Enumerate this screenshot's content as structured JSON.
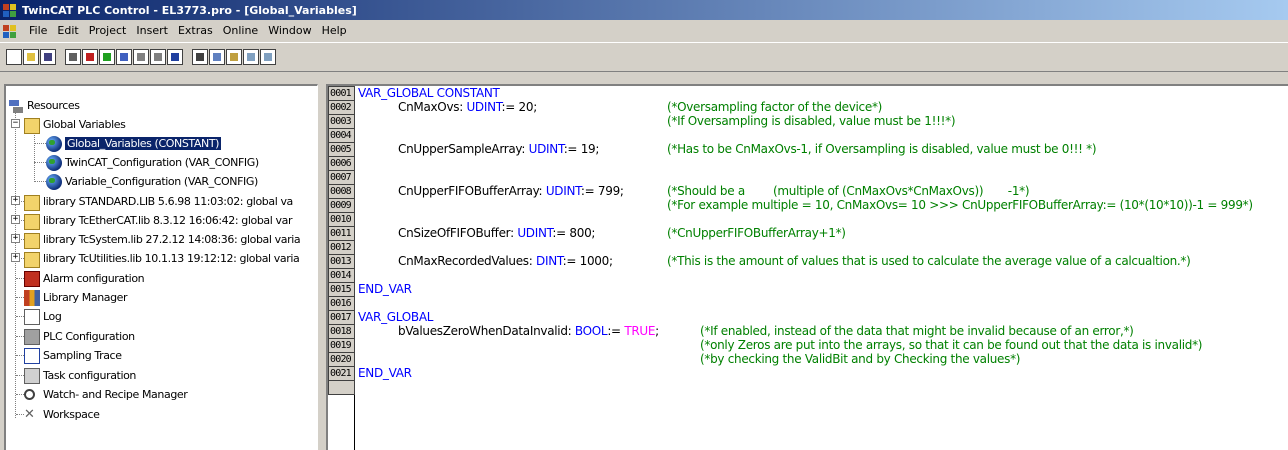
{
  "window": {
    "title": "TwinCAT PLC Control - EL3773.pro - [Global_Variables]"
  },
  "menu": [
    "File",
    "Edit",
    "Project",
    "Insert",
    "Extras",
    "Online",
    "Window",
    "Help"
  ],
  "toolbar": {
    "buttons": [
      "new",
      "open",
      "save",
      "compile",
      "login",
      "logout",
      "run",
      "stop",
      "step",
      "cut",
      "copy",
      "paste",
      "find",
      "find-next"
    ]
  },
  "tree": {
    "items": [
      {
        "label": "Resources",
        "icon": "resources-icon"
      },
      {
        "label": "Global Variables",
        "icon": "folder-open-icon"
      },
      {
        "label": "Global_Variables (CONSTANT)",
        "icon": "globe-icon",
        "selected": true
      },
      {
        "label": "TwinCAT_Configuration (VAR_CONFIG)",
        "icon": "globe-icon"
      },
      {
        "label": "Variable_Configuration (VAR_CONFIG)",
        "icon": "globe-icon"
      },
      {
        "label": "library STANDARD.LIB 5.6.98 11:03:02: global va",
        "icon": "folder-icon"
      },
      {
        "label": "library TcEtherCAT.lib 8.3.12 16:06:42: global var",
        "icon": "folder-icon"
      },
      {
        "label": "library TcSystem.lib 27.2.12 14:08:36: global varia",
        "icon": "folder-icon"
      },
      {
        "label": "library TcUtilities.lib 10.1.13 19:12:12: global varia",
        "icon": "folder-icon"
      },
      {
        "label": "Alarm configuration",
        "icon": "alarm-icon"
      },
      {
        "label": "Library Manager",
        "icon": "library-manager-icon"
      },
      {
        "label": "Log",
        "icon": "log-icon"
      },
      {
        "label": "PLC Configuration",
        "icon": "plc-configuration-icon"
      },
      {
        "label": "Sampling Trace",
        "icon": "sampling-trace-icon"
      },
      {
        "label": "Task configuration",
        "icon": "task-configuration-icon"
      },
      {
        "label": "Watch- and Recipe Manager",
        "icon": "magnifier-icon"
      },
      {
        "label": "Workspace",
        "icon": "tools-icon"
      }
    ]
  },
  "editor": {
    "lines": [
      {
        "num": "0001",
        "kw": "VAR_GLOBAL CONSTANT"
      },
      {
        "num": "0002",
        "name": "CnMaxOvs: ",
        "type": "UDINT",
        "assign": ":= 20;",
        "comment": "(*Oversampling factor of the device*)"
      },
      {
        "num": "0003",
        "comment": "(*If Oversampling is disabled, value must be 1!!!*)"
      },
      {
        "num": "0004"
      },
      {
        "num": "0005",
        "name": "CnUpperSampleArray: ",
        "type": "UDINT",
        "assign": ":= 19;",
        "comment": "(*Has to be CnMaxOvs-1, if Oversampling is disabled, value must be 0!!! *)"
      },
      {
        "num": "0006"
      },
      {
        "num": "0007"
      },
      {
        "num": "0008",
        "name": "CnUpperFIFOBufferArray: ",
        "type": "UDINT",
        "assign": ":= 799;",
        "comment": "(*Should be a        (multiple of (CnMaxOvs*CnMaxOvs))       -1*)"
      },
      {
        "num": "0009",
        "comment": "(*For example multiple = 10, CnMaxOvs= 10 >>> CnUpperFIFOBufferArray:= (10*(10*10))-1 = 999*)"
      },
      {
        "num": "0010"
      },
      {
        "num": "0011",
        "name": "CnSizeOfFIFOBuffer: ",
        "type": "UDINT",
        "assign": ":= 800;",
        "comment": "(*CnUpperFIFOBufferArray+1*)"
      },
      {
        "num": "0012"
      },
      {
        "num": "0013",
        "name": "CnMaxRecordedValues: ",
        "type": "DINT",
        "assign": ":= 1000;",
        "comment": "(*This is the amount of values that is used to calculate the average value of a calcualtion.*)"
      },
      {
        "num": "0014"
      },
      {
        "num": "0015",
        "kw": "END_VAR"
      },
      {
        "num": "0016"
      },
      {
        "num": "0017",
        "kw": "VAR_GLOBAL"
      },
      {
        "num": "0018",
        "name": "bValuesZeroWhenDataInvalid: ",
        "type": "BOOL",
        "assign": ":= ",
        "bool": "TRUE",
        "assign2": ";",
        "comment": "(*If enabled, instead of the data that might be invalid because of an error,*)"
      },
      {
        "num": "0019",
        "comment": "(*only Zeros are put into the arrays, so that it can be found out that the data is invalid*)"
      },
      {
        "num": "0020",
        "comment": "(*by checking the ValidBit and by Checking the values*)"
      },
      {
        "num": "0021",
        "kw": "END_VAR"
      }
    ]
  }
}
